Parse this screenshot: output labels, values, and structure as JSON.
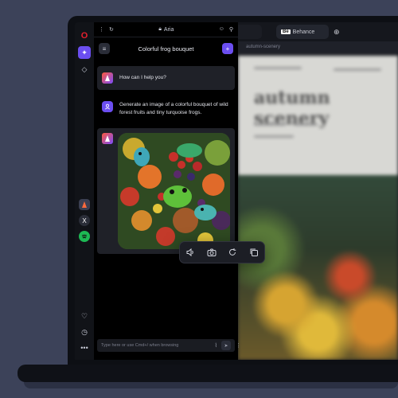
{
  "browser": {
    "tab_title": "Aria",
    "tabs": [
      {
        "label": "#"
      },
      {
        "label": "Behance",
        "badge": "Bē"
      }
    ],
    "address_text": "autumn-scenery",
    "page_heading_visible": "autumn scenery"
  },
  "sidebar": {
    "items": [
      {
        "name": "opera-logo"
      },
      {
        "name": "aria-ai"
      },
      {
        "name": "pinboard"
      },
      {
        "name": "aria-app"
      },
      {
        "name": "x-app",
        "glyph": "X"
      },
      {
        "name": "spotify-app"
      }
    ],
    "bottom": [
      "heart",
      "history",
      "more"
    ]
  },
  "aria": {
    "chat_title": "Colorful frog bouquet",
    "messages": [
      {
        "role": "aria",
        "text": "How can I help you?"
      },
      {
        "role": "user",
        "text": "Generate an image of a colorful bouquet of wild forest fruits and tiny turquoise frogs."
      },
      {
        "role": "aria",
        "type": "image"
      }
    ],
    "input_placeholder": "Type here or use Cmd+/ when browsing"
  },
  "toolbar": {
    "actions": [
      "speaker-icon",
      "camera-icon",
      "refresh-icon",
      "copy-icon"
    ]
  },
  "colors": {
    "accent": "#6b4ef0",
    "opera_red": "#e4202e",
    "background": "#3c4259"
  }
}
